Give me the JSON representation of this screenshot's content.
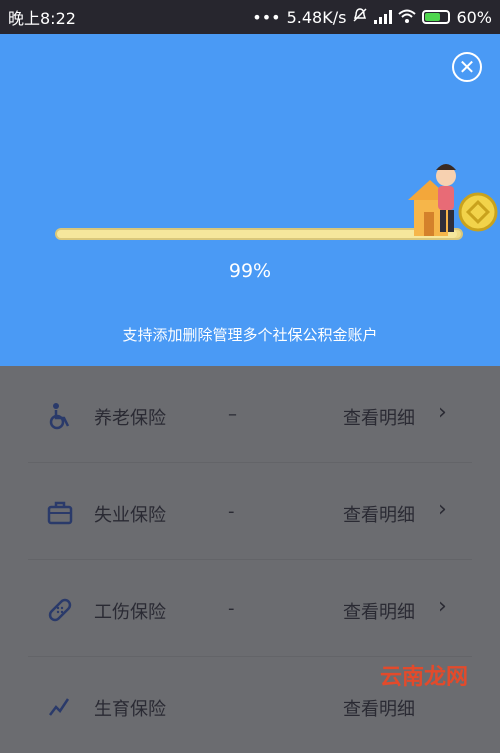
{
  "status_bar": {
    "time": "晚上8:22",
    "speed": "5.48K/s",
    "battery": "60%"
  },
  "progress": {
    "value": 0.99,
    "label": "99%"
  },
  "tagline": "支持添加删除管理多个社保公积金账户",
  "insurance_rows": [
    {
      "name": "养老保险",
      "amount": "–",
      "detail": "查看明细",
      "icon": "wheelchair-icon"
    },
    {
      "name": "失业保险",
      "amount": "-",
      "detail": "查看明细",
      "icon": "briefcase-icon"
    },
    {
      "name": "工伤保险",
      "amount": "-",
      "detail": "查看明细",
      "icon": "bandage-icon"
    },
    {
      "name": "生育保险",
      "amount": "",
      "detail": "查看明细",
      "icon": "stork-icon"
    }
  ],
  "watermark": "云南龙网",
  "colors": {
    "panel_blue": "#4a9af5",
    "dim_overlay": "#6b6c70",
    "progress_yellow": "#f0dd8a"
  }
}
